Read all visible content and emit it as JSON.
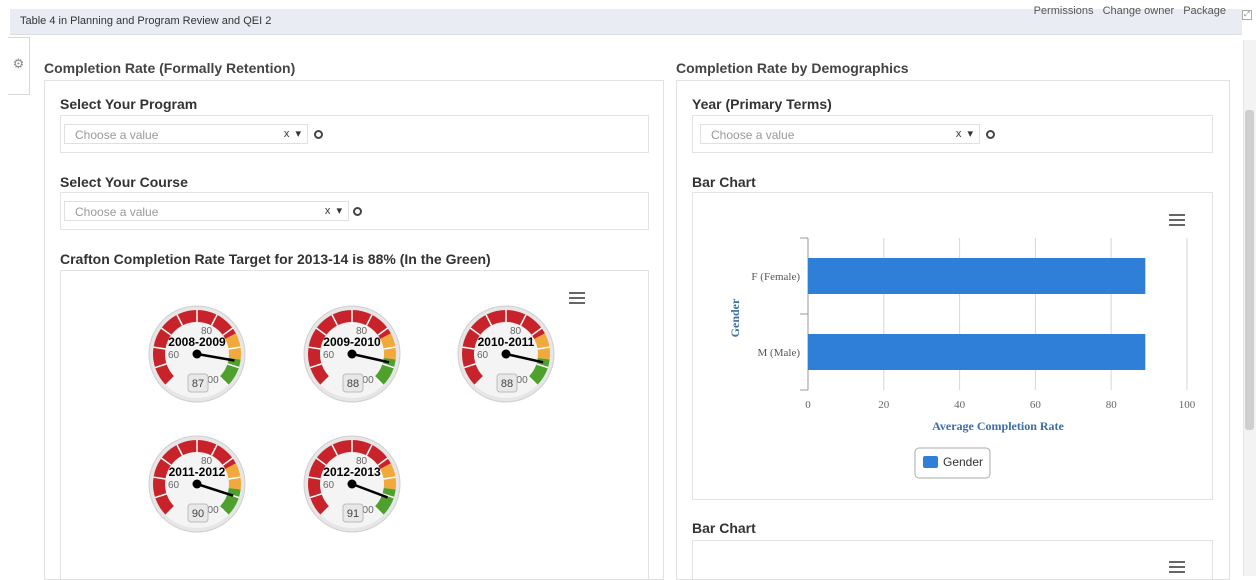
{
  "topbar": {
    "title": "Table 4 in Planning and Program Review and QEI 2",
    "links": [
      "Permissions",
      "Change owner",
      "Package"
    ]
  },
  "left": {
    "section_title": "Completion Rate (Formally Retention)",
    "program_label": "Select Your Program",
    "program_placeholder": "Choose a value",
    "course_label": "Select Your Course",
    "course_placeholder": "Choose a value",
    "gauge_heading": "Crafton Completion Rate Target for 2013-14 is 88% (In the Green)",
    "gauges": [
      {
        "title": "2008-2009",
        "value": 87
      },
      {
        "title": "2009-2010",
        "value": 88
      },
      {
        "title": "2010-2011",
        "value": 88
      },
      {
        "title": "2011-2012",
        "value": 90
      },
      {
        "title": "2012-2013",
        "value": 91
      }
    ],
    "gauge_scale": {
      "min": 0,
      "max": 100,
      "ticks": [
        "60",
        "80",
        "100"
      ]
    }
  },
  "right": {
    "section_title": "Completion Rate by Demographics",
    "year_label": "Year (Primary Terms)",
    "year_placeholder": "Choose a value",
    "chart_label": "Bar Chart",
    "chart2_label": "Bar Chart"
  },
  "chooser_ctrls": {
    "clear": "x",
    "arrow": "▾"
  },
  "colors": {
    "bar": "#2f7ed8",
    "gauge_red": "#c8232b",
    "gauge_yellow": "#f2a93b",
    "gauge_green": "#4ea12c",
    "axis_title": "#3b6ea5"
  },
  "chart_data": [
    {
      "type": "bar",
      "orientation": "horizontal",
      "categories": [
        "F (Female)",
        "M (Male)"
      ],
      "series": [
        {
          "name": "Gender",
          "values": [
            89,
            89
          ]
        }
      ],
      "xlabel": "Average Completion Rate",
      "ylabel": "Gender",
      "xlim": [
        0,
        100
      ],
      "xticks": [
        "0",
        "20",
        "40",
        "60",
        "80",
        "100"
      ],
      "legend": "bottom-center",
      "grid": true
    }
  ]
}
